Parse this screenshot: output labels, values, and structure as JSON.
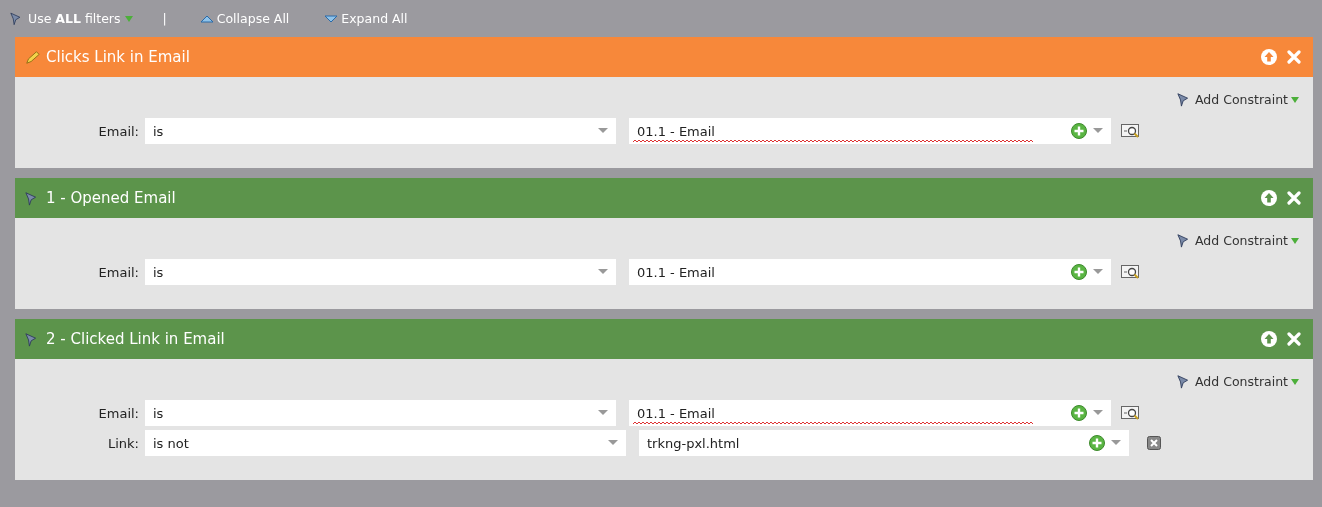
{
  "toolbar": {
    "filter_mode": {
      "prefix": "Use ",
      "bold": "ALL",
      "suffix": " filters"
    },
    "separator": "|",
    "collapse": "Collapse All",
    "expand": "Expand All"
  },
  "filters": [
    {
      "title": "Clicks Link in Email",
      "selected": true,
      "add_constraint": "Add Constraint",
      "constraints": [
        {
          "kind": "primary",
          "label": "Email:",
          "operator": "is",
          "value": "01.1 - Email",
          "misspelled": true
        }
      ]
    },
    {
      "title": "1 - Opened Email",
      "selected": false,
      "add_constraint": "Add Constraint",
      "constraints": [
        {
          "kind": "primary",
          "label": "Email:",
          "operator": "is",
          "value": "01.1 - Email"
        }
      ]
    },
    {
      "title": "2 - Clicked Link in Email",
      "selected": false,
      "add_constraint": "Add Constraint",
      "constraints": [
        {
          "kind": "primary",
          "label": "Email:",
          "operator": "is",
          "value": "01.1 - Email",
          "misspelled": true
        },
        {
          "kind": "added",
          "label": "Link:",
          "operator": "is not",
          "value": "trkng-pxl.html"
        }
      ]
    }
  ]
}
